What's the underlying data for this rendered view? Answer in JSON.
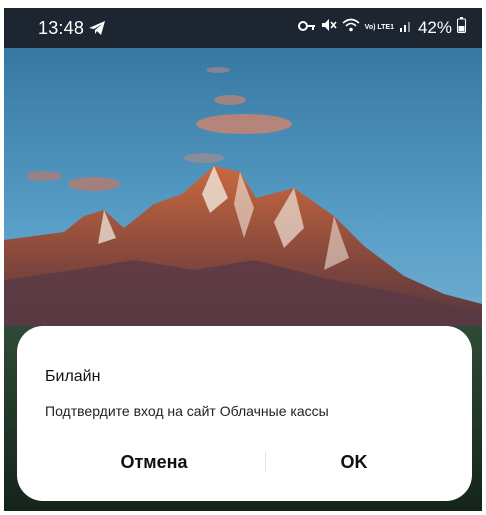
{
  "status_bar": {
    "time": "13:48",
    "battery": "42%",
    "network_label": "Vo) LTE1",
    "icons": [
      "telegram-icon",
      "key-icon",
      "mute-icon",
      "wifi-icon",
      "volte-icon",
      "signal-icon",
      "battery-icon"
    ]
  },
  "dialog": {
    "title": "Билайн",
    "message": "Подтвердите вход на сайт Облачные кассы",
    "cancel_label": "Отмена",
    "ok_label": "OK"
  },
  "colors": {
    "status_bar_bg": "#1d2530",
    "dialog_bg": "#ffffff",
    "text": "#111111"
  }
}
